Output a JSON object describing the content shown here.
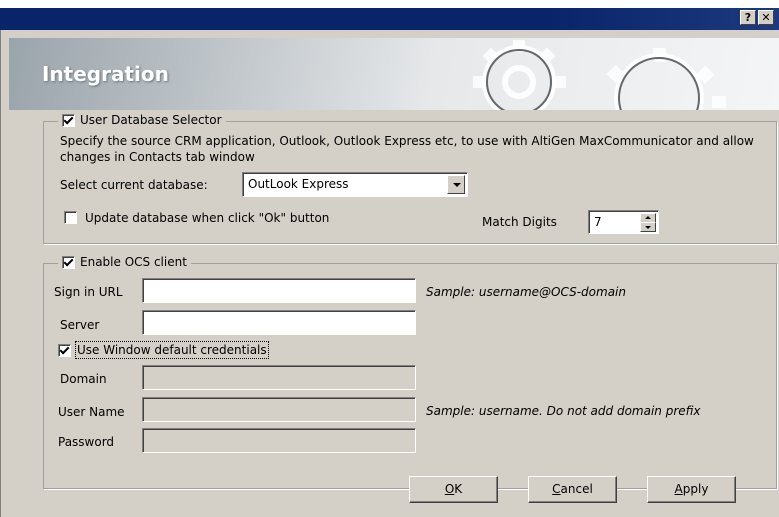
{
  "window": {
    "help_button": "?",
    "close_button": "✕"
  },
  "banner": {
    "title": "Integration"
  },
  "user_db": {
    "legend": "User Database Selector",
    "checked": true,
    "description": "Specify the source CRM application, Outlook, Outlook Express etc, to use with AltiGen MaxCommunicator and allow changes in Contacts tab window",
    "select_label": "Select current database:",
    "select_value": "OutLook Express",
    "update_label": "Update database when click \"Ok\" button",
    "update_checked": false,
    "match_digits_label": "Match Digits",
    "match_digits_value": "7"
  },
  "ocs": {
    "legend": "Enable OCS client",
    "checked": true,
    "sign_in_label": "Sign in URL",
    "sign_in_value": "",
    "sign_in_sample": "Sample: username@OCS-domain",
    "server_label": "Server",
    "server_value": "",
    "default_creds_label": "Use Window default credentials",
    "default_creds_checked": true,
    "domain_label": "Domain",
    "domain_value": "",
    "username_label": "User Name",
    "username_value": "",
    "username_sample": "Sample: username. Do not add domain prefix",
    "password_label": "Password",
    "password_value": ""
  },
  "buttons": {
    "ok_mnemonic": "O",
    "ok_rest": "K",
    "cancel_mnemonic": "C",
    "cancel_rest": "ancel",
    "apply_mnemonic": "A",
    "apply_rest": "pply"
  }
}
